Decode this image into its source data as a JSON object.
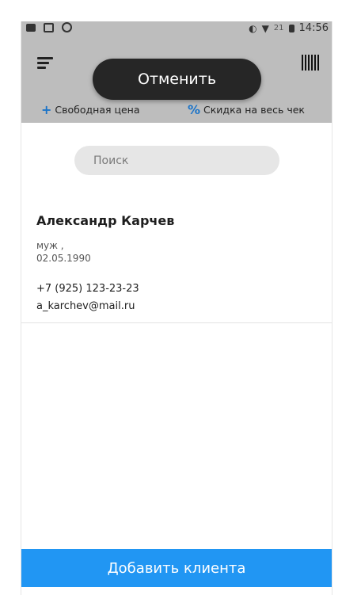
{
  "status_bar": {
    "time": "14:56",
    "battery_text": "21"
  },
  "header": {
    "menu_icon": "hamburger-menu-icon",
    "barcode_icon": "barcode-icon",
    "toast_label": "Отменить",
    "free_price_label": "Свободная цена",
    "discount_label": "Скидка на весь чек",
    "free_price_symbol": "+",
    "discount_symbol": "%"
  },
  "search": {
    "placeholder": "Поиск"
  },
  "clients": [
    {
      "name": "Александр Карчев",
      "gender": "муж ,",
      "birthdate": "02.05.1990",
      "phone": "+7 (925) 123-23-23",
      "email": "a_karchev@mail.ru"
    }
  ],
  "add_button_label": "Добавить клиента",
  "colors": {
    "accent": "#2196f3",
    "toast_bg": "#262626",
    "icon_blue": "#1a73c8"
  }
}
